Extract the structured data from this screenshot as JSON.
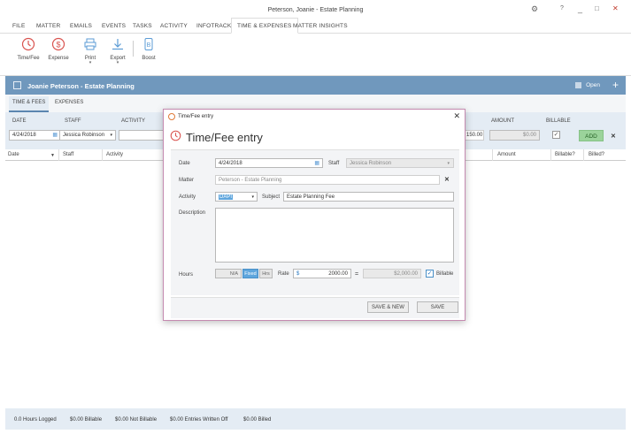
{
  "window": {
    "title": "Peterson, Joanie - Estate Planning",
    "settings_icon": "gear-icon",
    "help": "?",
    "minimize": "_",
    "maximize": "□",
    "close": "✕"
  },
  "menu": {
    "items": [
      "FILE",
      "MATTER",
      "EMAILS",
      "EVENTS",
      "TASKS",
      "ACTIVITY",
      "INFOTRACK",
      "TIME & EXPENSES",
      "MATTER INSIGHTS"
    ]
  },
  "ribbon": {
    "items": [
      {
        "label": "Time/Fee",
        "icon": "clock-icon"
      },
      {
        "label": "Expense",
        "icon": "dollar-icon"
      },
      {
        "label": "Print",
        "icon": "printer-icon",
        "dropdown": "▾"
      },
      {
        "label": "Export",
        "icon": "download-icon",
        "dropdown": "▾"
      },
      {
        "label": "Boost",
        "icon": "boost-icon"
      }
    ]
  },
  "matter": {
    "name": "Joanie Peterson - Estate Planning",
    "open_label": "Open",
    "add": "+"
  },
  "tabs": [
    "TIME & FEES",
    "EXPENSES"
  ],
  "filters": {
    "date_label": "DATE",
    "date_value": "4/24/2018",
    "staff_label": "STAFF",
    "staff_value": "Jessica Robinson",
    "activity_label": "ACTIVITY",
    "amount_label": "AMOUNT",
    "amount_value": "$0.00",
    "partial_value": "150.00",
    "billable_label": "BILLABLE",
    "add_label": "ADD",
    "remove": "✕"
  },
  "grid": {
    "columns": [
      "Date",
      "Staff",
      "Activity",
      "Amount",
      "Billable?",
      "Billed?"
    ]
  },
  "status": {
    "hours": "0.0 Hours Logged",
    "billable": "$0.00 Billable",
    "not_billable": "$0.00 Not Billable",
    "written_off": "$0.00 Entries Written Off",
    "billed": "$0.00 Billed"
  },
  "dialog": {
    "title": "Time/Fee entry",
    "heading": "Time/Fee entry",
    "close": "✕",
    "date_label": "Date",
    "date_value": "4/24/2018",
    "staff_label": "Staff",
    "staff_value": "Jessica Robinson",
    "matter_label": "Matter",
    "matter_value": "Peterson - Estate Planning",
    "activity_label": "Activity",
    "activity_value": "DAPI",
    "subject_label": "Subject",
    "subject_value": "Estate Planning Fee",
    "description_label": "Description",
    "description_value": "",
    "hours_label": "Hours",
    "hours_value": "N/A",
    "fixed_label": "Fixed",
    "hrs_label": "Hrs",
    "rate_label": "Rate",
    "rate_currency": "$",
    "rate_value": "2000.00",
    "equals": "=",
    "total_value": "$2,000.00",
    "billable_label": "Billable",
    "save_new_label": "SAVE & NEW",
    "save_label": "SAVE"
  },
  "colors": {
    "accent": "#7098bd",
    "dialog_border": "#c58ab0",
    "add_button": "#9bd39b",
    "icon_red": "#d9534f"
  }
}
